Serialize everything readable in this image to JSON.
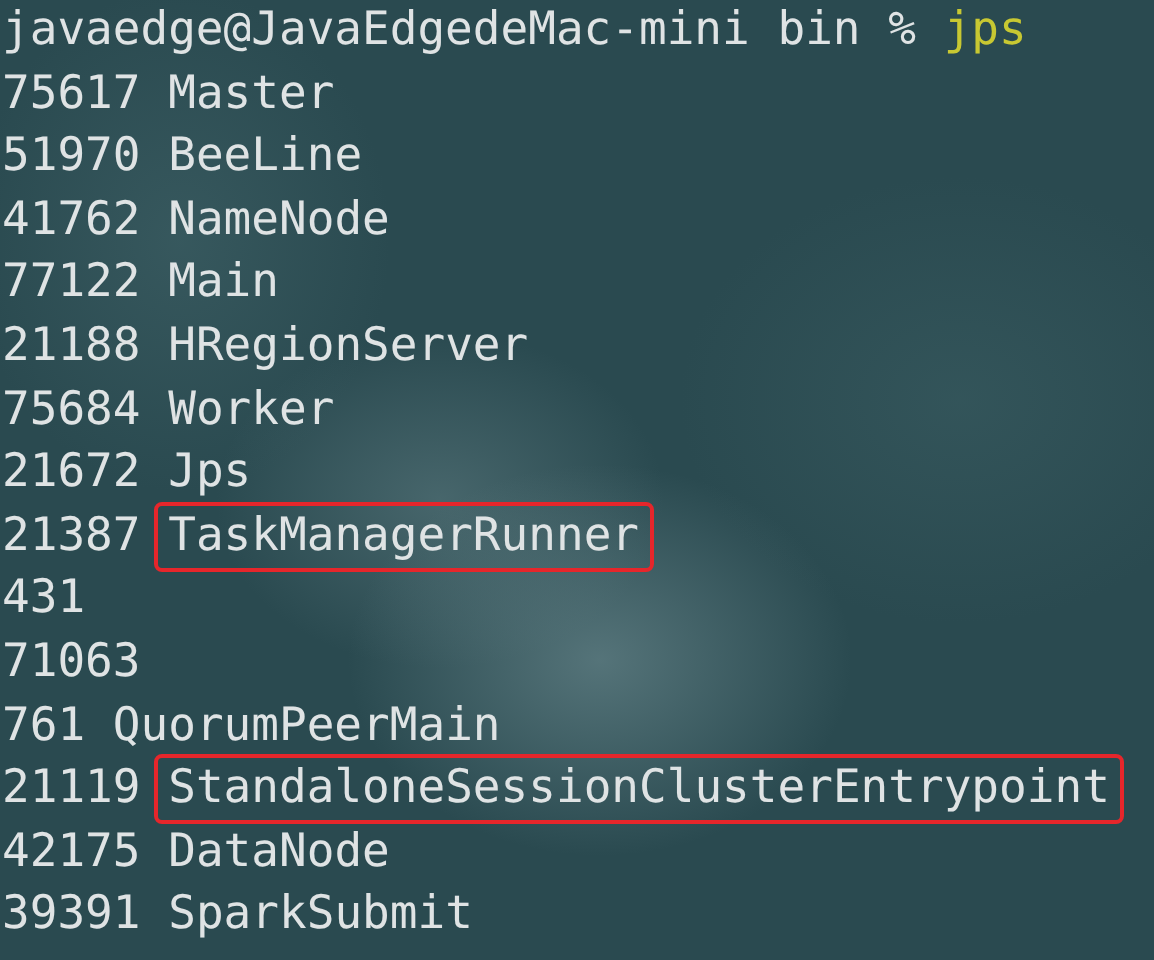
{
  "prompt": {
    "context": "javaedge@JavaEdgedeMac-mini bin %",
    "command": "jps"
  },
  "processes": [
    {
      "pid": "75617",
      "name": "Master",
      "highlighted": false
    },
    {
      "pid": "51970",
      "name": "BeeLine",
      "highlighted": false
    },
    {
      "pid": "41762",
      "name": "NameNode",
      "highlighted": false
    },
    {
      "pid": "77122",
      "name": "Main",
      "highlighted": false
    },
    {
      "pid": "21188",
      "name": "HRegionServer",
      "highlighted": false
    },
    {
      "pid": "75684",
      "name": "Worker",
      "highlighted": false
    },
    {
      "pid": "21672",
      "name": "Jps",
      "highlighted": false
    },
    {
      "pid": "21387",
      "name": "TaskManagerRunner",
      "highlighted": true
    },
    {
      "pid": "431"
    },
    {
      "pid": "71063"
    },
    {
      "pid": "761",
      "name": "QuorumPeerMain",
      "highlighted": false
    },
    {
      "pid": "21119",
      "name": "StandaloneSessionClusterEntrypoint",
      "highlighted": true
    },
    {
      "pid": "42175",
      "name": "DataNode",
      "highlighted": false
    },
    {
      "pid": "39391",
      "name": "SparkSubmit",
      "highlighted": false
    }
  ]
}
